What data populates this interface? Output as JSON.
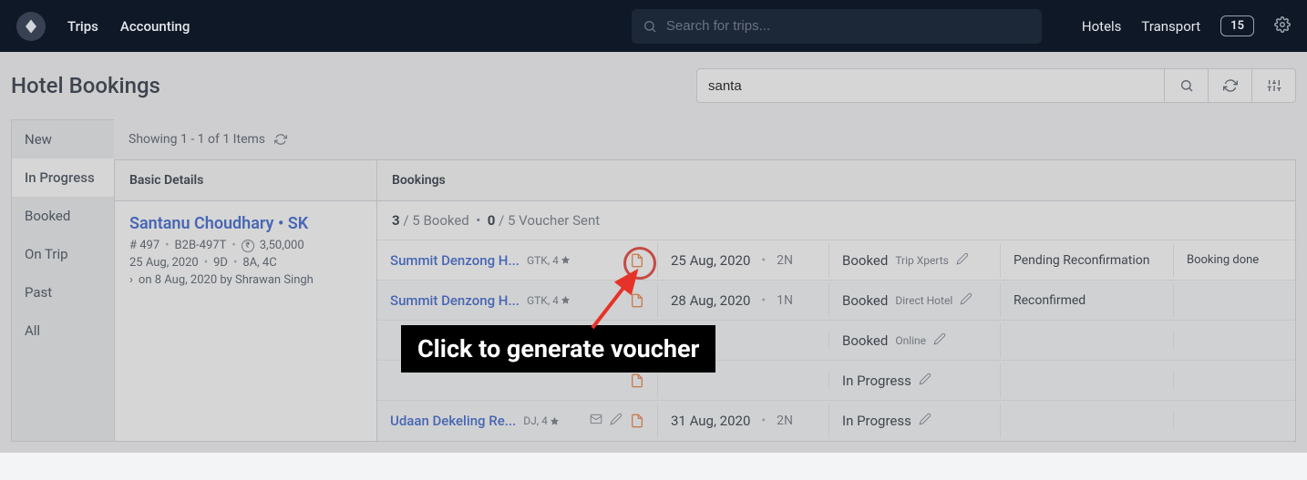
{
  "topbar": {
    "nav": {
      "trips": "Trips",
      "accounting": "Accounting"
    },
    "search_placeholder": "Search for trips...",
    "right": {
      "hotels": "Hotels",
      "transport": "Transport",
      "count": "15"
    }
  },
  "page": {
    "title": "Hotel Bookings",
    "filter_value": "santa"
  },
  "sidebar": {
    "items": [
      {
        "label": "New"
      },
      {
        "label": "In Progress"
      },
      {
        "label": "Booked"
      },
      {
        "label": "On Trip"
      },
      {
        "label": "Past"
      },
      {
        "label": "All"
      }
    ],
    "active_index": 1
  },
  "showing": "Showing 1 - 1 of 1 Items",
  "columns": {
    "basic": "Basic Details",
    "bookings": "Bookings"
  },
  "trip": {
    "customer": "Santanu Choudhary • SK",
    "id": "# 497",
    "b2b": "B2B-497T",
    "amount": "3,50,000",
    "date": "25 Aug, 2020",
    "duration": "9D",
    "pax": "8A, 4C",
    "created": "on 8 Aug, 2020 by Shrawan Singh"
  },
  "summary": {
    "booked_n": "3",
    "booked_d": "5",
    "booked_label": "Booked",
    "voucher_n": "0",
    "voucher_d": "5",
    "voucher_label": "Voucher Sent"
  },
  "rows": [
    {
      "hotel": "Summit Denzong H...",
      "code": "GTK, 4",
      "date": "25 Aug, 2020",
      "nights": "2N",
      "status": "Booked",
      "source": "Trip Xperts",
      "reconf": "Pending Reconfirmation",
      "done": "Booking done",
      "highlight": true,
      "doc_highlight": true,
      "show_pencil_source": true
    },
    {
      "hotel": "Summit Denzong H...",
      "code": "GTK, 4",
      "date": "28 Aug, 2020",
      "nights": "1N",
      "status": "Booked",
      "source": "Direct Hotel",
      "reconf": "Reconfirmed",
      "done": "",
      "highlight": false,
      "show_pencil_source": true
    },
    {
      "hotel": "",
      "code": "",
      "date": "",
      "nights": "",
      "status": "Booked",
      "source": "Online",
      "reconf": "",
      "done": "",
      "highlight": false,
      "show_pencil_source": true,
      "hidden": true
    },
    {
      "hotel": "",
      "code": "",
      "date": "",
      "nights": "",
      "status": "In Progress",
      "source": "",
      "reconf": "",
      "done": "",
      "highlight": false,
      "show_pencil_status": true,
      "hidden": true
    },
    {
      "hotel": "Udaan Dekeling Re...",
      "code": "DJ, 4",
      "date": "31 Aug, 2020",
      "nights": "2N",
      "status": "In Progress",
      "source": "",
      "reconf": "",
      "done": "",
      "highlight": false,
      "show_mail": true,
      "show_pencil_hotel": true,
      "show_pencil_status": true
    }
  ],
  "tooltip": "Click to generate voucher"
}
